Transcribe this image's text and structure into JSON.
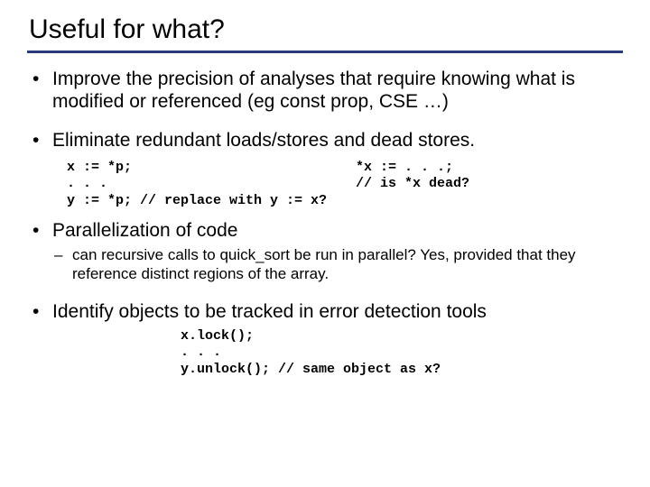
{
  "slide": {
    "title": "Useful for what?",
    "bullets": {
      "b1": "Improve the precision of analyses that require knowing what is modified or referenced (eg const prop, CSE …)",
      "b2": "Eliminate redundant loads/stores and dead stores.",
      "b3": "Parallelization of code",
      "b3_sub1": "can recursive calls to quick_sort be run in parallel? Yes, provided that they reference distinct regions of the array.",
      "b4": "Identify objects to be tracked in error detection tools"
    },
    "code1": {
      "left": "x := *p;\n. . .\ny := *p; // replace with y := x?",
      "right": "*x := . . .;\n// is *x dead?"
    },
    "code2": "x.lock();\n. . .\ny.unlock(); // same object as x?"
  }
}
